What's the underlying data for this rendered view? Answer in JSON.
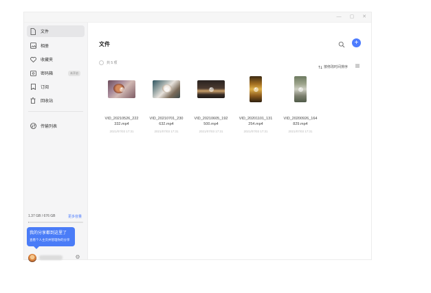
{
  "sidebar": {
    "items": [
      {
        "label": "文件",
        "icon": "file-icon"
      },
      {
        "label": "相册",
        "icon": "photo-icon"
      },
      {
        "label": "收藏夹",
        "icon": "heart-icon"
      },
      {
        "label": "密码箱",
        "icon": "safe-icon",
        "badge": "未开启"
      },
      {
        "label": "订阅",
        "icon": "bookmark-icon"
      },
      {
        "label": "回收站",
        "icon": "trash-icon"
      },
      {
        "label": "传输列表",
        "icon": "transfer-icon"
      }
    ],
    "storage": {
      "text": "1.37 GB / 676 GB",
      "link": "更多容量",
      "used_fraction": 0.002
    },
    "tooltip": {
      "title": "我的分享都到这里了",
      "subtitle": "查看个人主页并管理你的分享"
    }
  },
  "main": {
    "title": "文件",
    "count": "共 5 项",
    "sort_label": "按修改时间排序",
    "files": [
      {
        "name": "VID_20210526_222332.mp4",
        "date": "2021/07/03 17:31"
      },
      {
        "name": "VID_20210701_230632.mp4",
        "date": "2021/07/03 17:31"
      },
      {
        "name": "VID_20210605_192500.mp4",
        "date": "2021/07/03 17:31"
      },
      {
        "name": "VID_20201101_131254.mp4",
        "date": "2021/07/03 17:31"
      },
      {
        "name": "VID_20200926_164829.mp4",
        "date": "2021/07/03 17:31"
      }
    ]
  },
  "colors": {
    "accent": "#4d7cfe",
    "tooltip": "#4a7cf7"
  }
}
